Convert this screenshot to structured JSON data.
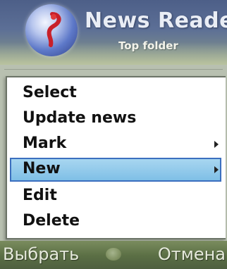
{
  "header": {
    "app_title": "News Reader",
    "subtitle": "Top folder",
    "app_icon": "news-reader-icon"
  },
  "menu": {
    "items": [
      {
        "label": "Select",
        "has_submenu": false,
        "selected": false
      },
      {
        "label": "Update news",
        "has_submenu": false,
        "selected": false
      },
      {
        "label": "Mark",
        "has_submenu": true,
        "selected": false
      },
      {
        "label": "New",
        "has_submenu": true,
        "selected": true
      },
      {
        "label": "Edit",
        "has_submenu": false,
        "selected": false
      },
      {
        "label": "Delete",
        "has_submenu": false,
        "selected": false
      }
    ],
    "submenu_icon": "triangle-right-icon"
  },
  "softkeys": {
    "left_label": "Выбрать",
    "right_label": "Отмена",
    "center_icon": "select-key-icon"
  },
  "colors": {
    "header_top": "#4d5f88",
    "highlight": "#8fcaed",
    "highlight_border": "#3b6fbf",
    "softkey_bar": "#5a6e44"
  }
}
